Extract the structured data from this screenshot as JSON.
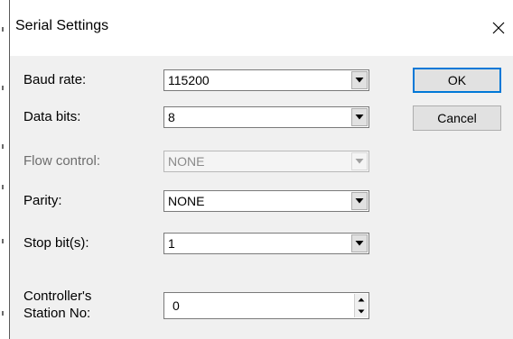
{
  "window": {
    "title": "Serial Settings"
  },
  "icons": {
    "close": "close-icon",
    "dropdown": "chevron-down-icon",
    "spin_up": "spin-up-icon",
    "spin_down": "spin-down-icon"
  },
  "fields": {
    "baud_rate": {
      "label": "Baud rate:",
      "value": "115200"
    },
    "data_bits": {
      "label": "Data bits:",
      "value": "8"
    },
    "flow_control": {
      "label": "Flow control:",
      "value": "NONE",
      "disabled": true
    },
    "parity": {
      "label": "Parity:",
      "value": "NONE"
    },
    "stop_bits": {
      "label": "Stop bit(s):",
      "value": "1"
    },
    "station_no": {
      "label_line1": "Controller's",
      "label_line2": "Station No:",
      "value": "0"
    }
  },
  "buttons": {
    "ok": "OK",
    "cancel": "Cancel"
  },
  "colors": {
    "dialog_bg": "#f0f0f0",
    "default_button_border": "#0078d7"
  }
}
